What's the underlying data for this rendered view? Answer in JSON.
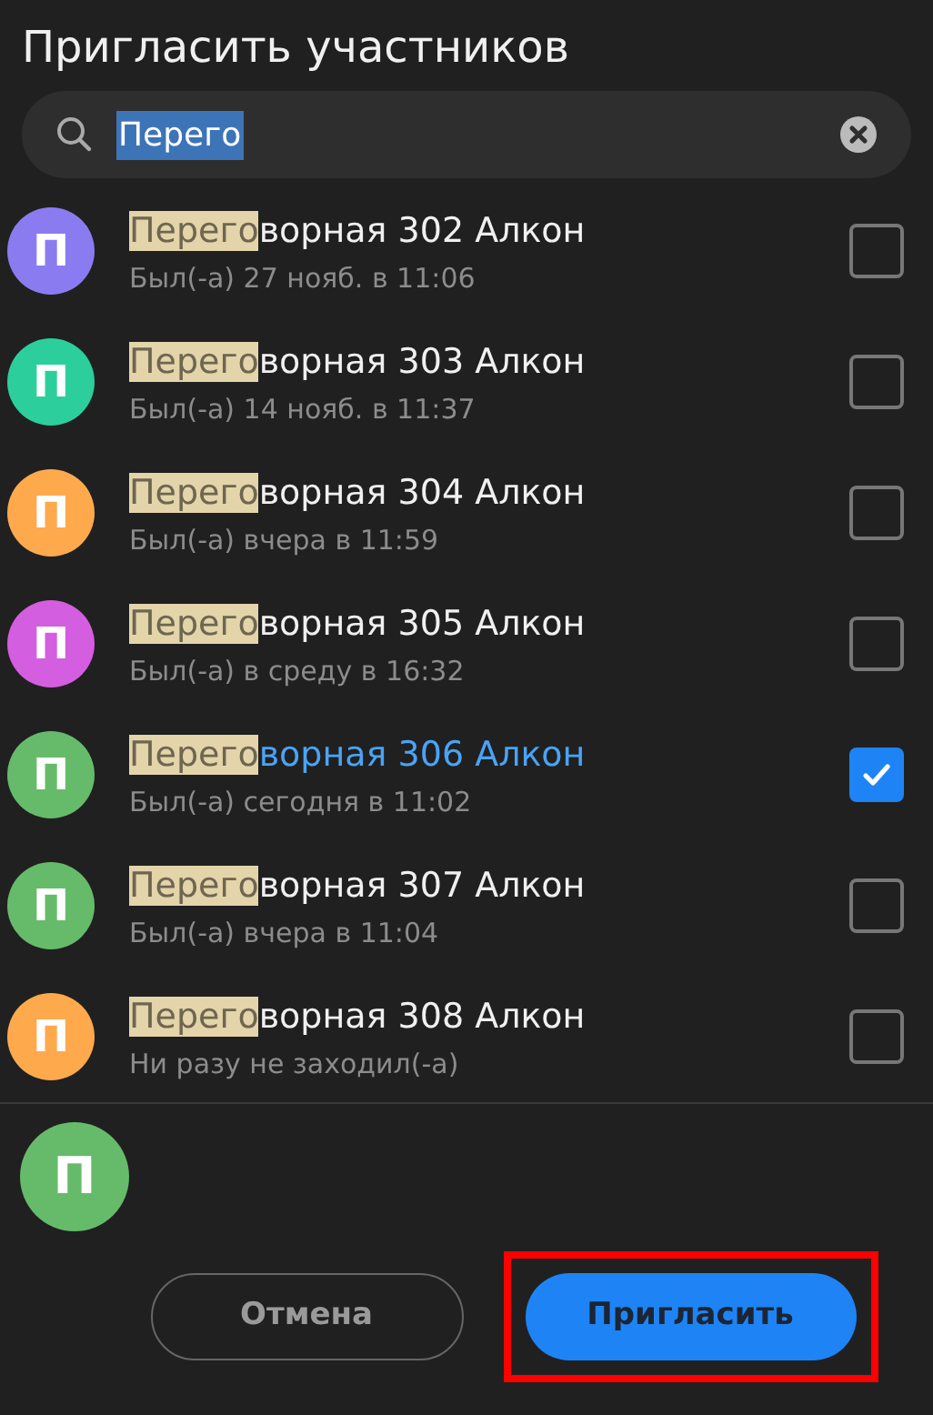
{
  "title": "Пригласить участников",
  "search": {
    "value": "Перего",
    "selected_text": true
  },
  "contacts": [
    {
      "initial": "П",
      "color": "#8a7cf0",
      "match": "Перего",
      "rest": "ворная 302 Алкон",
      "status": "Был(-а) 27 нояб. в 11:06",
      "selected": false
    },
    {
      "initial": "П",
      "color": "#2ccf9c",
      "match": "Перего",
      "rest": "ворная 303 Алкон",
      "status": "Был(-а) 14 нояб. в 11:37",
      "selected": false
    },
    {
      "initial": "П",
      "color": "#ffa94d",
      "match": "Перего",
      "rest": "ворная 304 Алкон",
      "status": "Был(-а) вчера в 11:59",
      "selected": false
    },
    {
      "initial": "П",
      "color": "#d45ee0",
      "match": "Перего",
      "rest": "ворная 305 Алкон",
      "status": "Был(-а) в среду в 16:32",
      "selected": false
    },
    {
      "initial": "П",
      "color": "#66bb6a",
      "match": "Перего",
      "rest": "ворная 306 Алкон",
      "status": "Был(-а) сегодня в 11:02",
      "selected": true
    },
    {
      "initial": "П",
      "color": "#66bb6a",
      "match": "Перего",
      "rest": "ворная 307 Алкон",
      "status": "Был(-а) вчера в 11:04",
      "selected": false
    },
    {
      "initial": "П",
      "color": "#ffa94d",
      "match": "Перего",
      "rest": "ворная 308 Алкон",
      "status": "Ни разу не заходил(-а)",
      "selected": false
    }
  ],
  "chosen": [
    {
      "initial": "П",
      "color": "#66bb6a"
    }
  ],
  "buttons": [
    {
      "label": "Отмена",
      "kind": "secondary",
      "highlighted": false
    },
    {
      "label": "Пригласить",
      "kind": "primary",
      "highlighted": true
    }
  ]
}
